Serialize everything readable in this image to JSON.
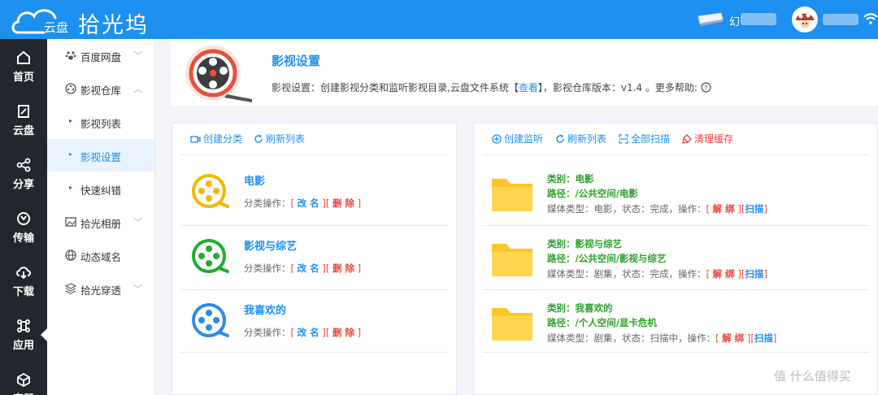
{
  "app": {
    "brand": "拾光坞",
    "logo_text": "云盘"
  },
  "topbar": {
    "hdd_name_prefix": "幻",
    "accent": "#1d8ff0"
  },
  "leftnav": [
    {
      "label": "首页",
      "icon": "home-icon"
    },
    {
      "label": "云盘",
      "icon": "cloud-disk-icon"
    },
    {
      "label": "分享",
      "icon": "share-icon"
    },
    {
      "label": "传输",
      "icon": "transfer-icon"
    },
    {
      "label": "下载",
      "icon": "download-icon"
    },
    {
      "label": "应用",
      "icon": "apps-icon"
    },
    {
      "label": "容器",
      "icon": "container-icon"
    }
  ],
  "submenu": {
    "baidu": "百度网盘",
    "vault": "影视仓库",
    "vault_list": "影视列表",
    "vault_settings": "影视设置",
    "quick_fix": "快速纠错",
    "album": "拾光相册",
    "ddns": "动态域名",
    "tunnel": "拾光穿透"
  },
  "header": {
    "title": "影视设置",
    "desc_before": "影视设置：创建影视分类和监听影视目录,云盘文件系统【",
    "desc_link": "查看",
    "desc_after": "】，影视仓库版本：v1.4 。更多帮助:"
  },
  "left_panel": {
    "create": "创建分类",
    "refresh": "刷新列表",
    "ops_label": "分类操作：",
    "rename": "改 名",
    "delete": "删 除",
    "categories": [
      {
        "name": "电影",
        "color": "#f5b700"
      },
      {
        "name": "影视与综艺",
        "color": "#1fad2e"
      },
      {
        "name": "我喜欢的",
        "color": "#2b8be8"
      }
    ]
  },
  "right_panel": {
    "create": "创建监听",
    "refresh": "刷新列表",
    "scan_all": "全部扫描",
    "clear": "清理缓存",
    "unbind": "解 绑",
    "scan": "扫描",
    "items": [
      {
        "cat": "类别：电影",
        "path": "路径：/公共空间/电影",
        "info": "媒体类型：电影，状态：完成，操作："
      },
      {
        "cat": "类别：影视与综艺",
        "path": "路径：/公共空间/影视与综艺",
        "info": "媒体类型：剧集，状态：完成，操作："
      },
      {
        "cat": "类别：我喜欢的",
        "path": "路径：/个人空间/显卡危机",
        "info": "媒体类型：剧集，状态：扫描中，操作："
      }
    ]
  },
  "watermark": "值 什么值得买"
}
